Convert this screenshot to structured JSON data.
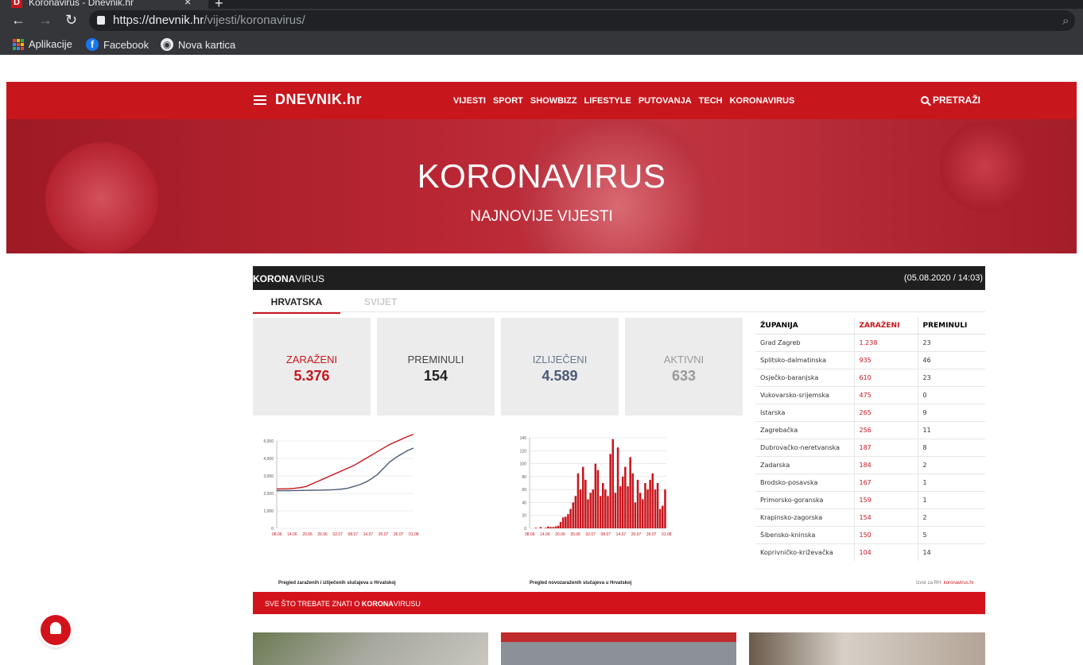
{
  "browser": {
    "tab_title": "Koronavirus - Dnevnik.hr",
    "favicon_letter": "D",
    "tab_close": "×",
    "new_tab": "+",
    "url_scheme": "https://",
    "url_host": "dnevnik.hr",
    "url_path": "/vijesti/koronavirus/",
    "bookmarks": [
      {
        "label": "Aplikacije",
        "icon": "apps-grid-icon"
      },
      {
        "label": "Facebook",
        "icon": "facebook-icon"
      },
      {
        "label": "Nova kartica",
        "icon": "globe-icon"
      }
    ]
  },
  "site": {
    "logo": "DNEVNIK.hr",
    "nav": [
      "VIJESTI",
      "SPORT",
      "SHOWBIZZ",
      "LIFESTYLE",
      "PUTOVANJA",
      "TECH",
      "KORONAVIRUS"
    ],
    "search_label": "PRETRAŽI",
    "brand_color": "#c8161d"
  },
  "hero": {
    "title": "KORONAVIRUS",
    "subtitle": "NAJNOVIJE VIJESTI"
  },
  "widget": {
    "brand_bold": "KORONA",
    "brand_rest": "VIRUS",
    "timestamp": "(05.08.2020 / 14:03)",
    "tabs": [
      "HRVATSKA",
      "SVIJET"
    ],
    "stats": [
      {
        "label": "ZARAŽENI",
        "value": "5.376",
        "color": "#c8161d"
      },
      {
        "label": "PREMINULI",
        "value": "154",
        "color": "#222222"
      },
      {
        "label": "IZLIJEČENI",
        "value": "4.589",
        "color": "#4a5a78"
      },
      {
        "label": "AKTIVNI",
        "value": "633",
        "color": "#999999"
      }
    ],
    "table": {
      "headers": [
        "ŽUPANIJA",
        "ZARAŽENI",
        "PREMINULI"
      ],
      "rows": [
        [
          "Grad Zagreb",
          "1.238",
          "23"
        ],
        [
          "Splitsko-dalmatinska",
          "935",
          "46"
        ],
        [
          "Osječko-baranjska",
          "610",
          "23"
        ],
        [
          "Vukovarsko-srijemska",
          "475",
          "0"
        ],
        [
          "Istarska",
          "265",
          "9"
        ],
        [
          "Zagrebačka",
          "256",
          "11"
        ],
        [
          "Dubrovačko-neretvanska",
          "187",
          "8"
        ],
        [
          "Zadarska",
          "184",
          "2"
        ],
        [
          "Brodsko-posavska",
          "167",
          "1"
        ],
        [
          "Primorsko-goranska",
          "159",
          "1"
        ],
        [
          "Krapinsko-zagorska",
          "154",
          "2"
        ],
        [
          "Šibensko-kninska",
          "150",
          "5"
        ],
        [
          "Koprivničko-križevačka",
          "104",
          "14"
        ]
      ]
    },
    "source_label": "Izvor za RH:",
    "source_link": "koronavirus.hr",
    "info_bar_prefix": "SVE ŠTO TREBATE ZNATI O ",
    "info_bar_bold": "KORONA",
    "info_bar_suffix": "VIRUSU"
  },
  "chart_data": [
    {
      "type": "line",
      "title": "Pregled zaraženih i izliječenih slučajeva u Hrvatskoj",
      "x": [
        "08.06",
        "14.06",
        "20.06",
        "26.06",
        "02.07",
        "08.07",
        "14.07",
        "20.07",
        "26.07",
        "01.08"
      ],
      "ylim": [
        0,
        5000
      ],
      "yticks": [
        "0",
        "1,000",
        "2,000",
        "3,000",
        "4,000",
        "5,000"
      ],
      "series": [
        {
          "color": "#c8161d",
          "values": [
            2250,
            2260,
            2270,
            2290,
            2330,
            2400,
            2550,
            2700,
            2850,
            3000,
            3150,
            3300,
            3450,
            3600,
            3800,
            4000,
            4200,
            4400,
            4600,
            4800,
            4950,
            5100,
            5250,
            5376
          ]
        },
        {
          "color": "#4a5a78",
          "values": [
            2150,
            2155,
            2160,
            2165,
            2170,
            2175,
            2180,
            2185,
            2190,
            2200,
            2220,
            2250,
            2300,
            2400,
            2500,
            2650,
            2850,
            3100,
            3450,
            3800,
            4050,
            4250,
            4450,
            4589
          ]
        }
      ]
    },
    {
      "type": "bar",
      "title": "Pregled novozaraženih slučajeva u Hrvatskoj",
      "x": [
        "08.06",
        "14.06",
        "20.06",
        "26.06",
        "02.07",
        "08.07",
        "14.07",
        "20.07",
        "26.07",
        "01.08"
      ],
      "ylim": [
        0,
        140
      ],
      "yticks": [
        "0",
        "20",
        "40",
        "60",
        "80",
        "100",
        "120",
        "140"
      ],
      "color": "#c8161d",
      "values": [
        0,
        0,
        1,
        0,
        2,
        0,
        1,
        3,
        2,
        2,
        3,
        4,
        10,
        17,
        18,
        22,
        30,
        40,
        50,
        85,
        60,
        95,
        75,
        45,
        55,
        60,
        100,
        90,
        50,
        70,
        60,
        50,
        115,
        138,
        55,
        125,
        65,
        80,
        95,
        65,
        110,
        85,
        40,
        75,
        55,
        45,
        70,
        60,
        75,
        85,
        60,
        70,
        30,
        35,
        60
      ]
    }
  ]
}
